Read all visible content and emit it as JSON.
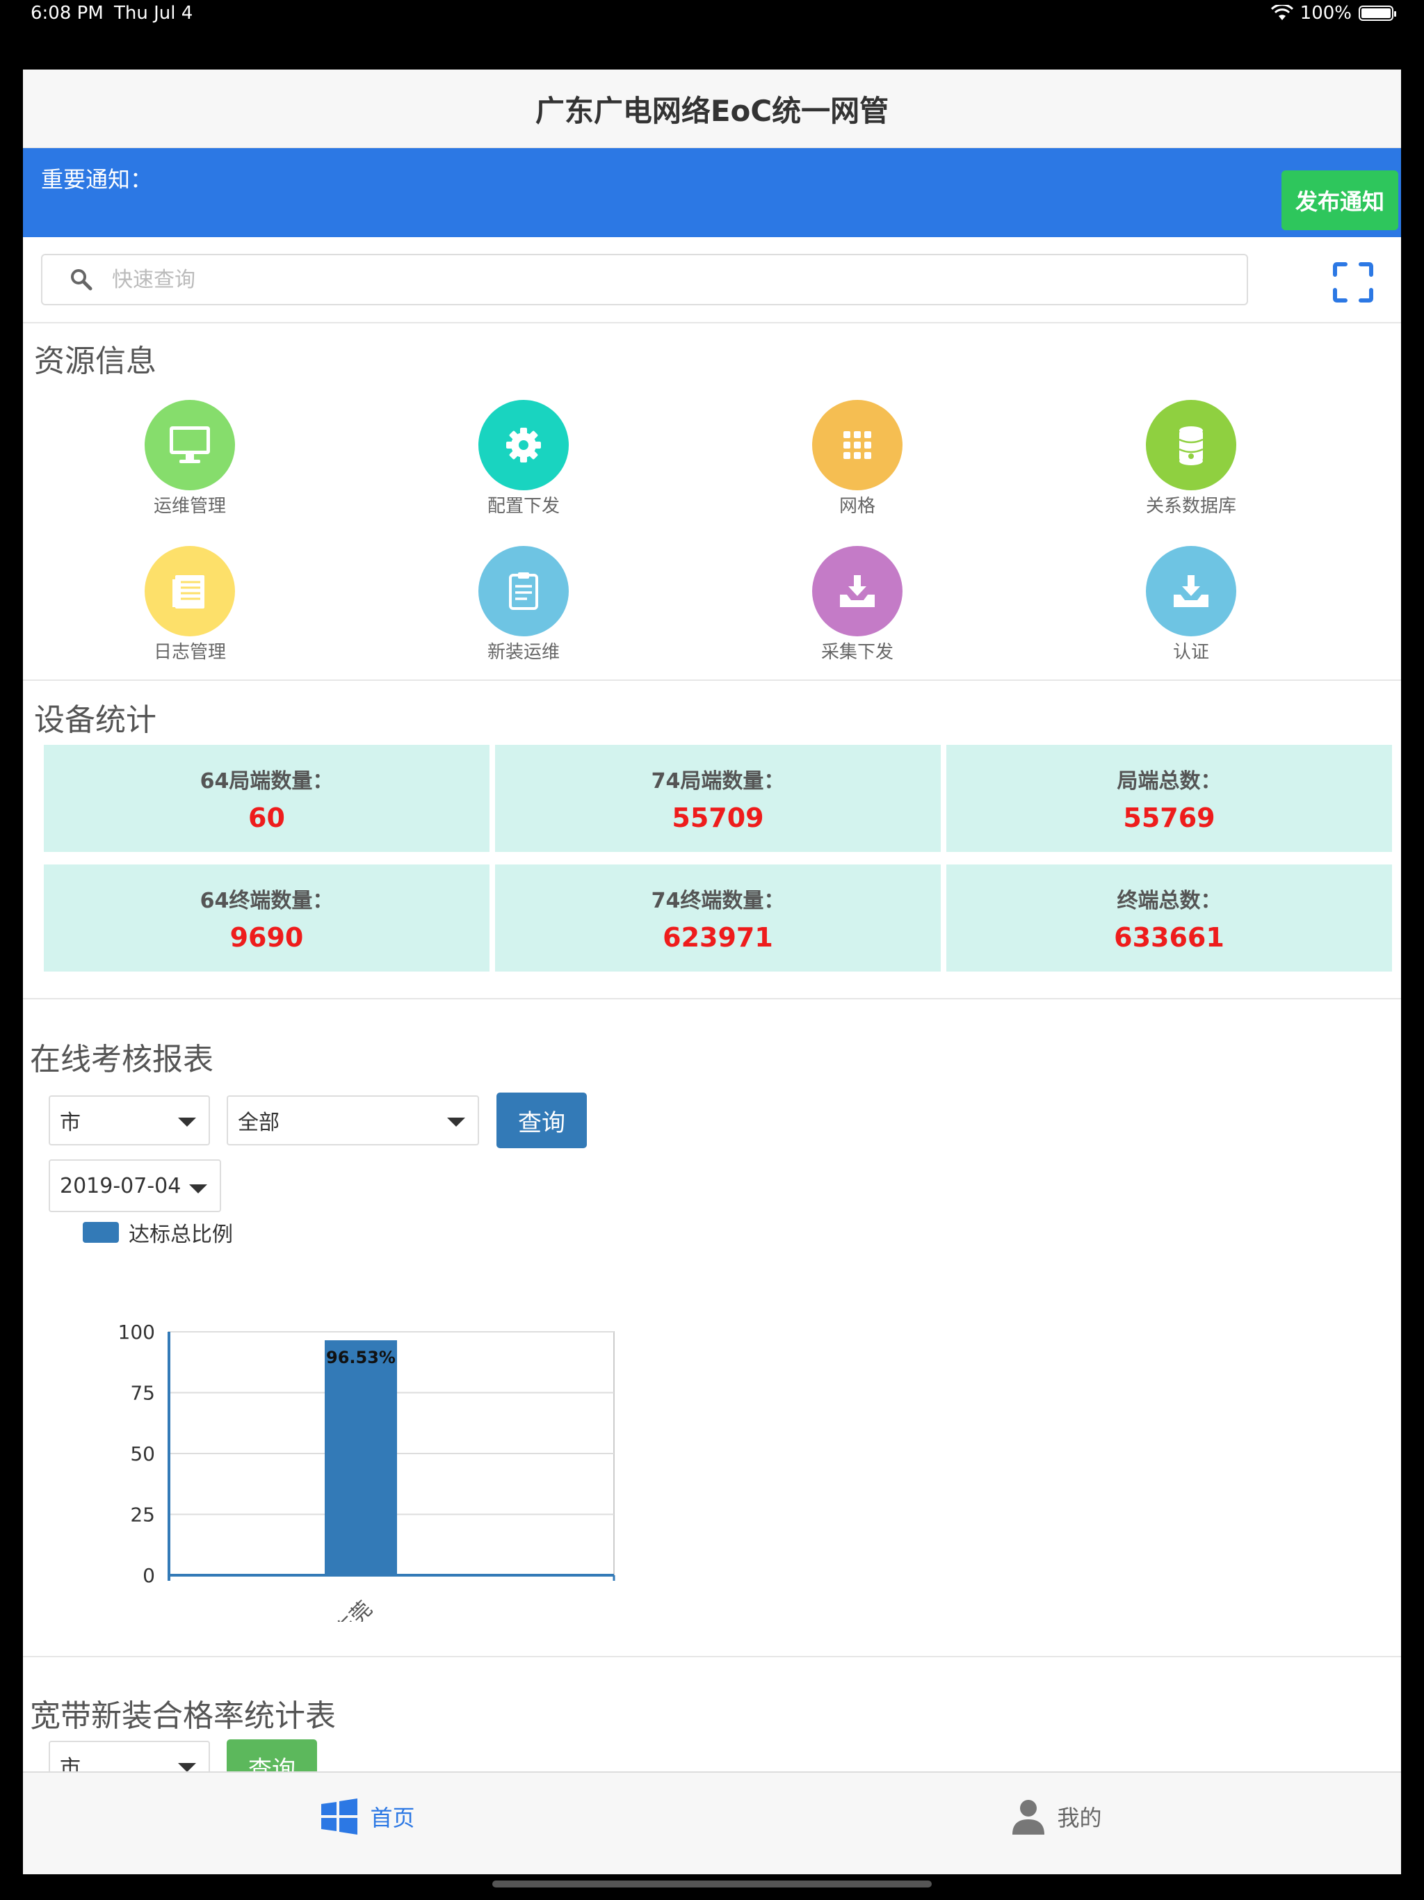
{
  "status_bar": {
    "time": "6:08 PM",
    "date": "Thu Jul 4",
    "battery": "100%"
  },
  "header": {
    "title": "广东广电网络EoC统一网管"
  },
  "notice": {
    "label": "重要通知：",
    "publish_label": "发布通知"
  },
  "search": {
    "placeholder": "快速查询"
  },
  "resources": {
    "title": "资源信息",
    "items": [
      {
        "label": "运维管理",
        "icon": "monitor-icon",
        "color": "#86dd6c"
      },
      {
        "label": "配置下发",
        "icon": "gear-icon",
        "color": "#19d4c0"
      },
      {
        "label": "网格",
        "icon": "grid-icon",
        "color": "#f5be52"
      },
      {
        "label": "关系数据库",
        "icon": "database-icon",
        "color": "#8fd040"
      },
      {
        "label": "日志管理",
        "icon": "document-icon",
        "color": "#fde06a"
      },
      {
        "label": "新装运维",
        "icon": "clipboard-icon",
        "color": "#6ec4e3"
      },
      {
        "label": "采集下发",
        "icon": "inbox-download-icon",
        "color": "#c47bc7"
      },
      {
        "label": "认证",
        "icon": "inbox-download-icon",
        "color": "#6ec4e3"
      }
    ]
  },
  "stats": {
    "title": "设备统计",
    "cards": [
      {
        "label": "64局端数量：",
        "value": "60"
      },
      {
        "label": "74局端数量：",
        "value": "55709"
      },
      {
        "label": "局端总数：",
        "value": "55769"
      },
      {
        "label": "64终端数量：",
        "value": "9690"
      },
      {
        "label": "74终端数量：",
        "value": "623971"
      },
      {
        "label": "终端总数：",
        "value": "633661"
      }
    ]
  },
  "online_report": {
    "title": "在线考核报表",
    "city_select": "市",
    "scope_select": "全部",
    "query_label": "查询",
    "date": "2019-07-04",
    "legend": "达标总比例"
  },
  "chart_data": {
    "type": "bar",
    "categories": [
      "东莞"
    ],
    "series": [
      {
        "name": "达标总比例",
        "values": [
          96.53
        ]
      }
    ],
    "data_labels": [
      "96.53%"
    ],
    "ylim": [
      0,
      100
    ],
    "yticks": [
      0,
      25,
      50,
      75,
      100
    ],
    "legend_position": "top-left",
    "grid": true,
    "color": "#337ab7"
  },
  "broadband": {
    "title": "宽带新装合格率统计表",
    "city_select": "市",
    "query_label": "查询"
  },
  "tabbar": {
    "home": "首页",
    "mine": "我的"
  }
}
